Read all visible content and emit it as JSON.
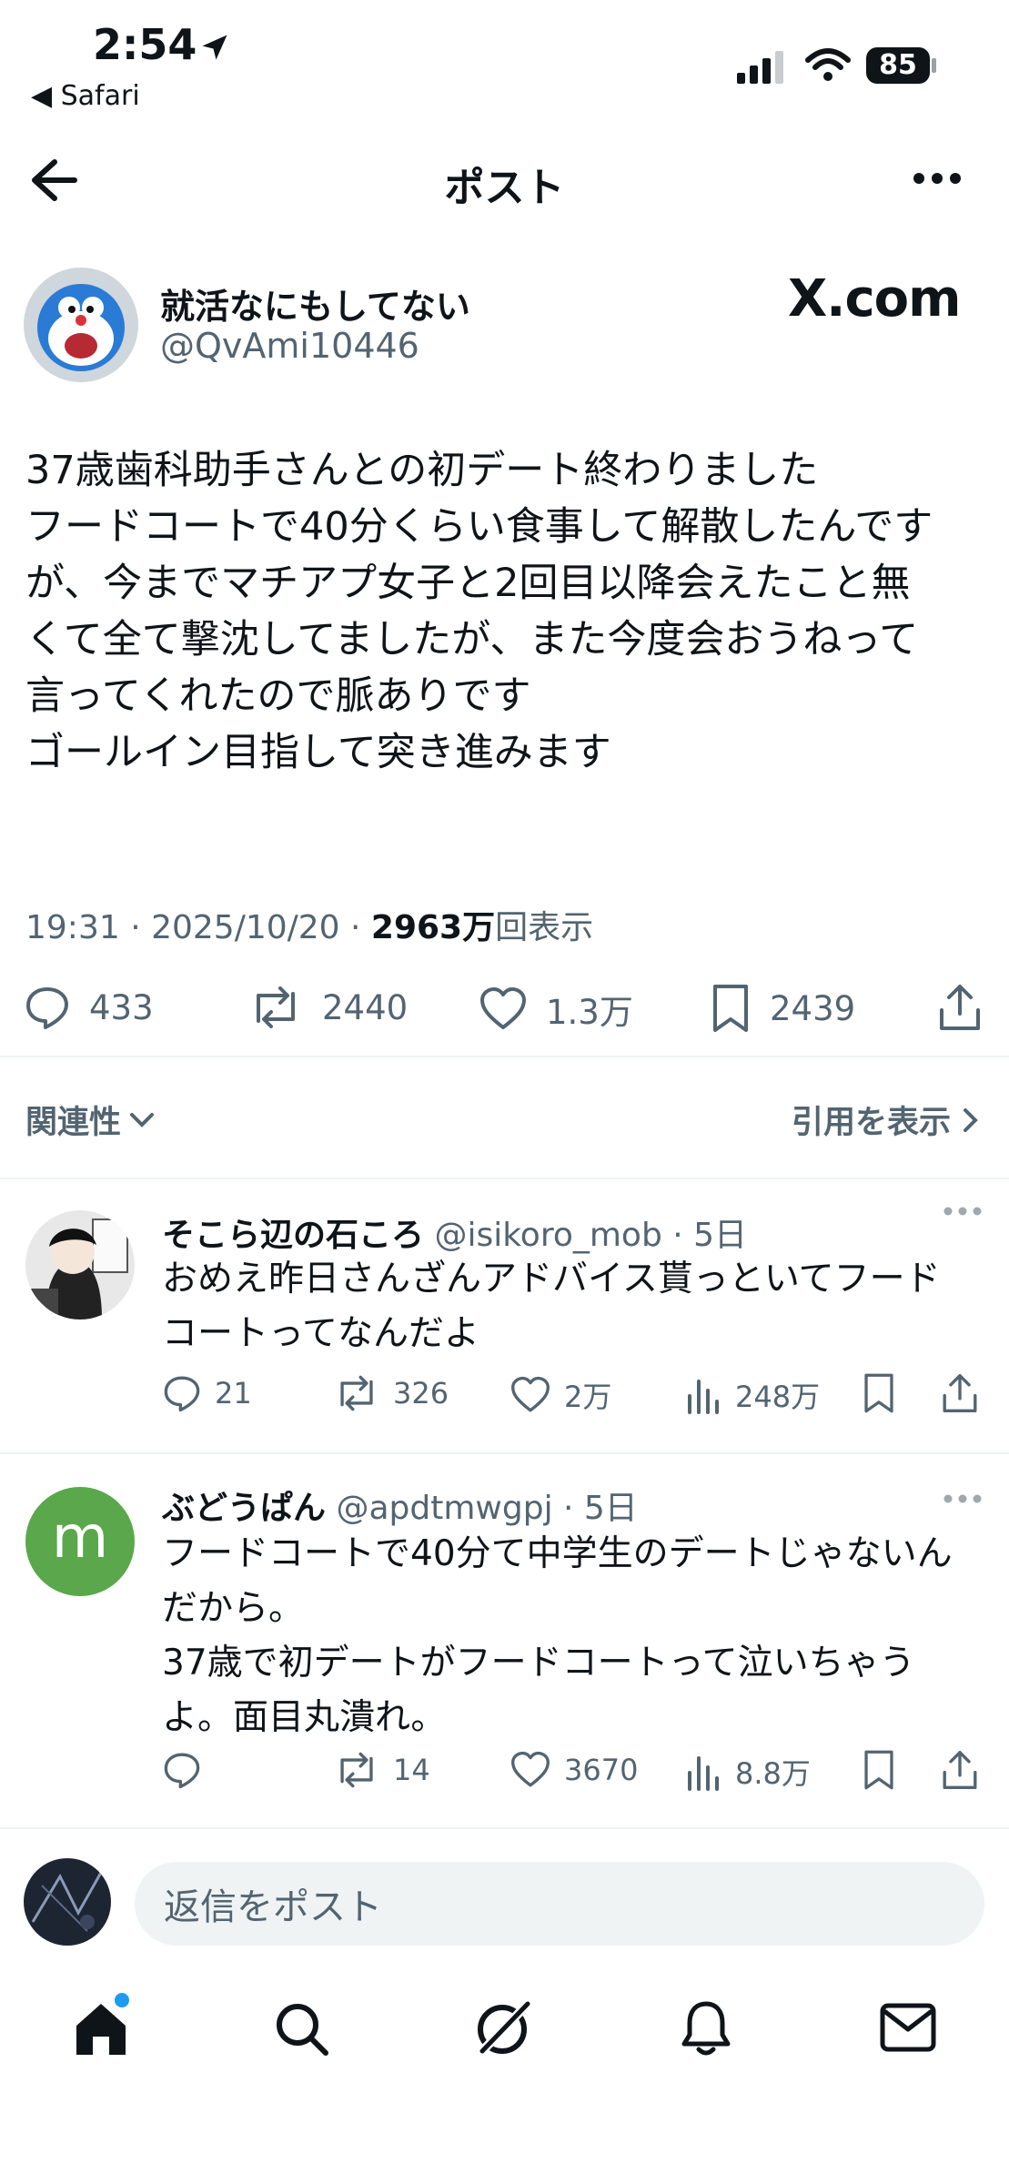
{
  "status_bar": {
    "time": "2:54",
    "back_app": "◀ Safari",
    "battery": "85"
  },
  "header": {
    "title": "ポスト"
  },
  "post": {
    "author_name": "就活なにもしてない",
    "author_handle": "@QvAmi10446",
    "badge": "X.com",
    "text_lines": [
      "37歳歯科助手さんとの初デート終わりました",
      "フードコートで40分くらい食事して解散したんです",
      "が、今までマチアプ女子と2回目以降会えたこと無",
      "くて全て撃沈してましたが、また今度会おうねって",
      "言ってくれたので脈ありです",
      "ゴールイン目指して突き進みます"
    ],
    "time": "19:31 · 2025/10/20 · ",
    "views_count": "2963万",
    "views_label": "回表示",
    "replies": "433",
    "reposts": "2440",
    "likes": "1.3万",
    "bookmarks": "2439"
  },
  "filters": {
    "related": "関連性",
    "quotes": "引用を表示"
  },
  "replies": [
    {
      "name": "そこら辺の石ころ",
      "handle": "@isikoro_mob · 5日",
      "text_lines": [
        "おめえ昨日さんざんアドバイス貰っといてフード",
        "コートってなんだよ"
      ],
      "replies": "21",
      "reposts": "326",
      "likes": "2万",
      "views": "248万"
    },
    {
      "name": "ぶどうぱん",
      "handle": "@apdtmwgpj · 5日",
      "avatar_letter": "m",
      "text_lines": [
        "フードコートで40分て中学生のデートじゃないん",
        "だから。",
        "37歳で初デートがフードコートって泣いちゃう",
        "よ。面目丸潰れ。"
      ],
      "replies": "",
      "reposts": "14",
      "likes": "3670",
      "views": "8.8万"
    }
  ],
  "composer": {
    "placeholder": "返信をポスト"
  },
  "colors": {
    "text": "#0f1419",
    "muted": "#536471",
    "divider": "#eff3f4",
    "accent": "#1d9bf0",
    "green_avatar": "#5aa84b"
  }
}
